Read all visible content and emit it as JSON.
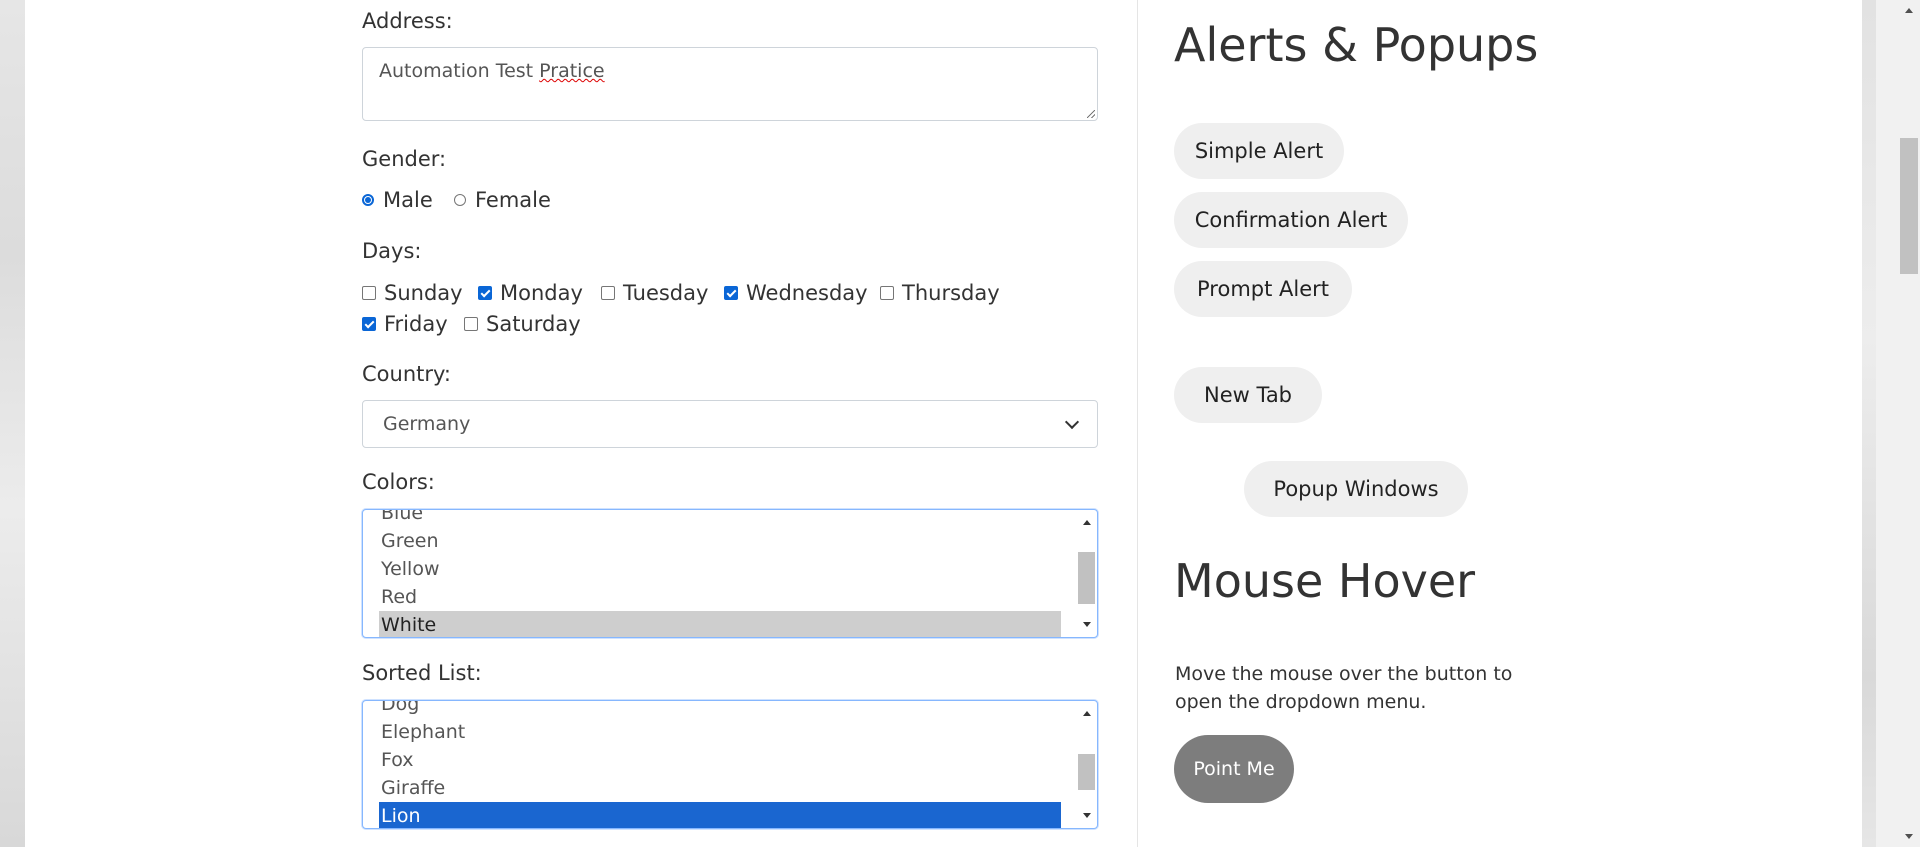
{
  "form": {
    "address_label": "Address:",
    "address_value_a": "Automation Test ",
    "address_value_b": "Pratice",
    "gender_label": "Gender:",
    "gender_options": [
      "Male",
      "Female"
    ],
    "gender_selected": "Male",
    "days_label": "Days:",
    "days": [
      {
        "label": "Sunday",
        "checked": false
      },
      {
        "label": "Monday",
        "checked": true
      },
      {
        "label": "Tuesday",
        "checked": false
      },
      {
        "label": "Wednesday",
        "checked": true
      },
      {
        "label": "Thursday",
        "checked": false
      },
      {
        "label": "Friday",
        "checked": true
      },
      {
        "label": "Saturday",
        "checked": false
      }
    ],
    "country_label": "Country:",
    "country_value": "Germany",
    "colors_label": "Colors:",
    "colors_items": [
      "Blue",
      "Green",
      "Yellow",
      "Red",
      "White"
    ],
    "colors_selected": "White",
    "sorted_label": "Sorted List:",
    "sorted_items": [
      "Dog",
      "Elephant",
      "Fox",
      "Giraffe",
      "Lion"
    ],
    "sorted_selected": "Lion"
  },
  "sidebar": {
    "alerts_heading": "Alerts & Popups",
    "simple_alert": "Simple Alert",
    "confirmation_alert": "Confirmation Alert",
    "prompt_alert": "Prompt Alert",
    "new_tab": "New Tab",
    "popup_windows": "Popup Windows",
    "mouse_hover_heading": "Mouse Hover",
    "mouse_hover_text": "Move the mouse over the button to open the dropdown menu.",
    "point_me": "Point Me"
  },
  "colors": {
    "accent": "#0a66d6",
    "selected_blue": "#1a66d0",
    "selected_gray": "#cecece",
    "pill_bg": "#efefef",
    "point_me_bg": "#7d7d7d"
  }
}
